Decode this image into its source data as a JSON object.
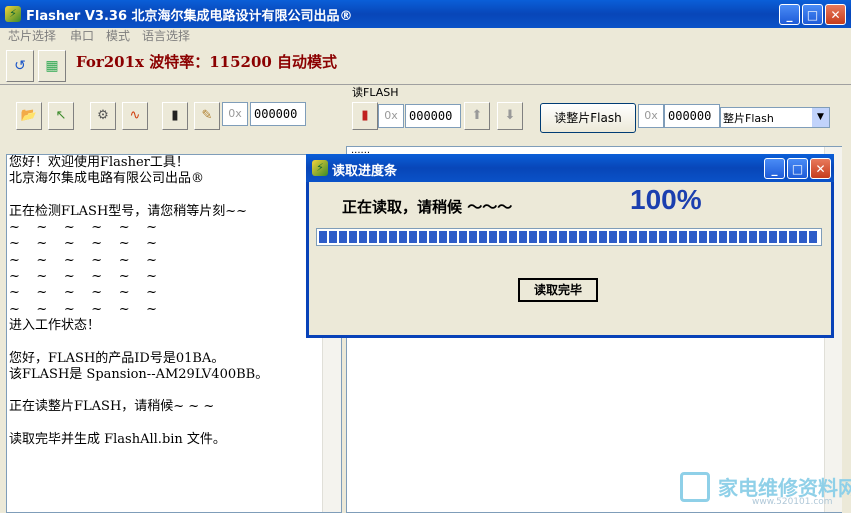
{
  "window": {
    "title": "Flasher V3.36  北京海尔集成电路设计有限公司出品®",
    "icon": "app-icon",
    "controls": [
      "minimize",
      "maximize",
      "close"
    ]
  },
  "menu": [
    "芯片选择",
    "串口",
    "模式",
    "语言选择"
  ],
  "toolbar": {
    "mode_text": "For201x 波特率：115200 自动模式"
  },
  "left_tools": {
    "hex_prefix": "0x",
    "hex_value": "000000"
  },
  "read_flash": {
    "group_label": "读FLASH",
    "hex_prefix": "0x",
    "hex_value": "000000",
    "read_button": "读整片Flash",
    "hex_prefix2": "0x",
    "hex_value2": "000000",
    "select_value": "整片Flash",
    "dots": "......"
  },
  "log": {
    "lines": [
      "您好！欢迎使用Flasher工具！",
      "北京海尔集成电路有限公司出品®",
      "",
      "正在检测FLASH型号，请您稍等片刻~~",
      "~    ~    ~    ~    ~    ~",
      "~    ~    ~    ~    ~    ~",
      "~    ~    ~    ~    ~    ~",
      "~    ~    ~    ~    ~    ~",
      "~    ~    ~    ~    ~    ~",
      "~    ~    ~    ~    ~    ~",
      "进入工作状态！",
      "",
      "您好，FLASH的产品ID号是01BA。",
      "该FLASH是 Spansion--AM29LV400BB。",
      "",
      "正在读整片FLASH，请稍候~ ~ ~",
      "",
      "读取完毕并生成 FlashAll.bin 文件。"
    ]
  },
  "dialog": {
    "title": "读取进度条",
    "status": "正在读取，请稍候 ～～～",
    "percent_text": "100%",
    "progress": 1.0,
    "done_button": "读取完毕"
  },
  "watermark": {
    "text": "家电维修资料网",
    "url": "www.520101.com"
  },
  "colors": {
    "titlebar": "#0A52C8",
    "percent": "#1B3FAF",
    "mode_text": "#8B0000",
    "progress": "#2E5CC8"
  }
}
